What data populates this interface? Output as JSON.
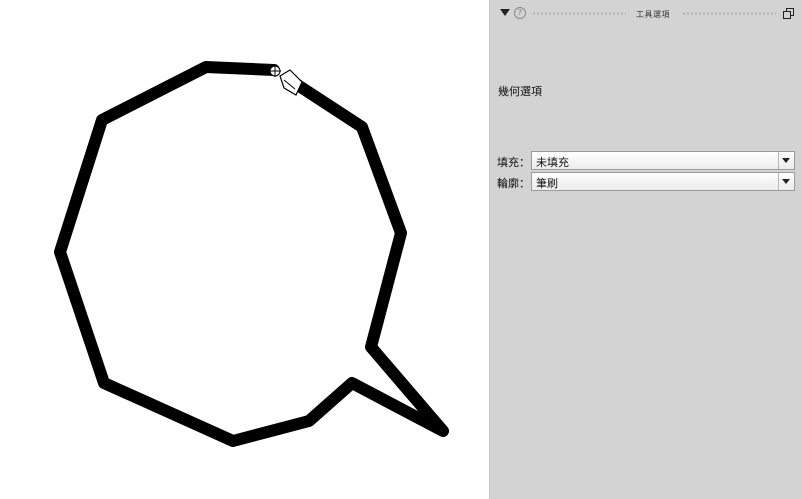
{
  "panel": {
    "title": "工具選項",
    "help_glyph": "?",
    "section_title": "幾何選項",
    "fill": {
      "label": "填充：",
      "value": "未填充"
    },
    "outline": {
      "label": "輪廓：",
      "value": "筆刷"
    }
  },
  "colors": {
    "panel_bg": "#d3d3d3",
    "canvas_bg": "#ffffff",
    "stroke": "#000000"
  }
}
